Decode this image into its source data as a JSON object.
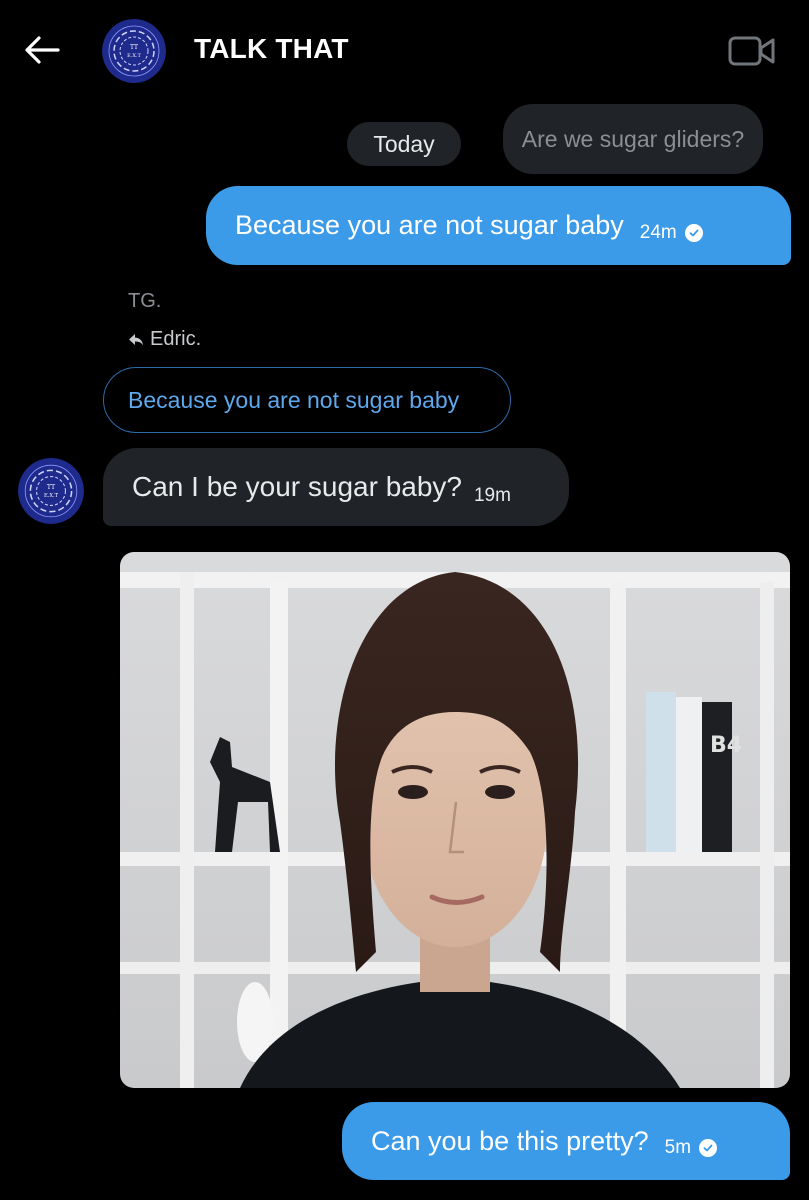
{
  "header": {
    "title": "TALK THAT",
    "back_icon": "back-arrow-icon",
    "video_icon": "video-camera-icon",
    "avatar_icon": "group-avatar"
  },
  "thread": {
    "day_label": "Today",
    "quoted_preview": "Are we sugar gliders?",
    "messages": [
      {
        "direction": "out",
        "text": "Because you are not sugar baby",
        "time": "24m",
        "status": "read"
      },
      {
        "direction": "in",
        "sender": "TG.",
        "reply_to": "Edric.",
        "reply_quote": "Because you are not sugar baby",
        "text": "Can I be your sugar baby?",
        "time": "19m",
        "attachment": "photo"
      },
      {
        "direction": "out",
        "text": "Can you be this pretty?",
        "time": "5m",
        "status": "read"
      }
    ]
  },
  "colors": {
    "background": "#000000",
    "outgoing_bubble": "#3c9be8",
    "incoming_bubble": "#202327",
    "reply_accent": "#5ea8ec",
    "avatar_blue": "#1e2a8c"
  }
}
